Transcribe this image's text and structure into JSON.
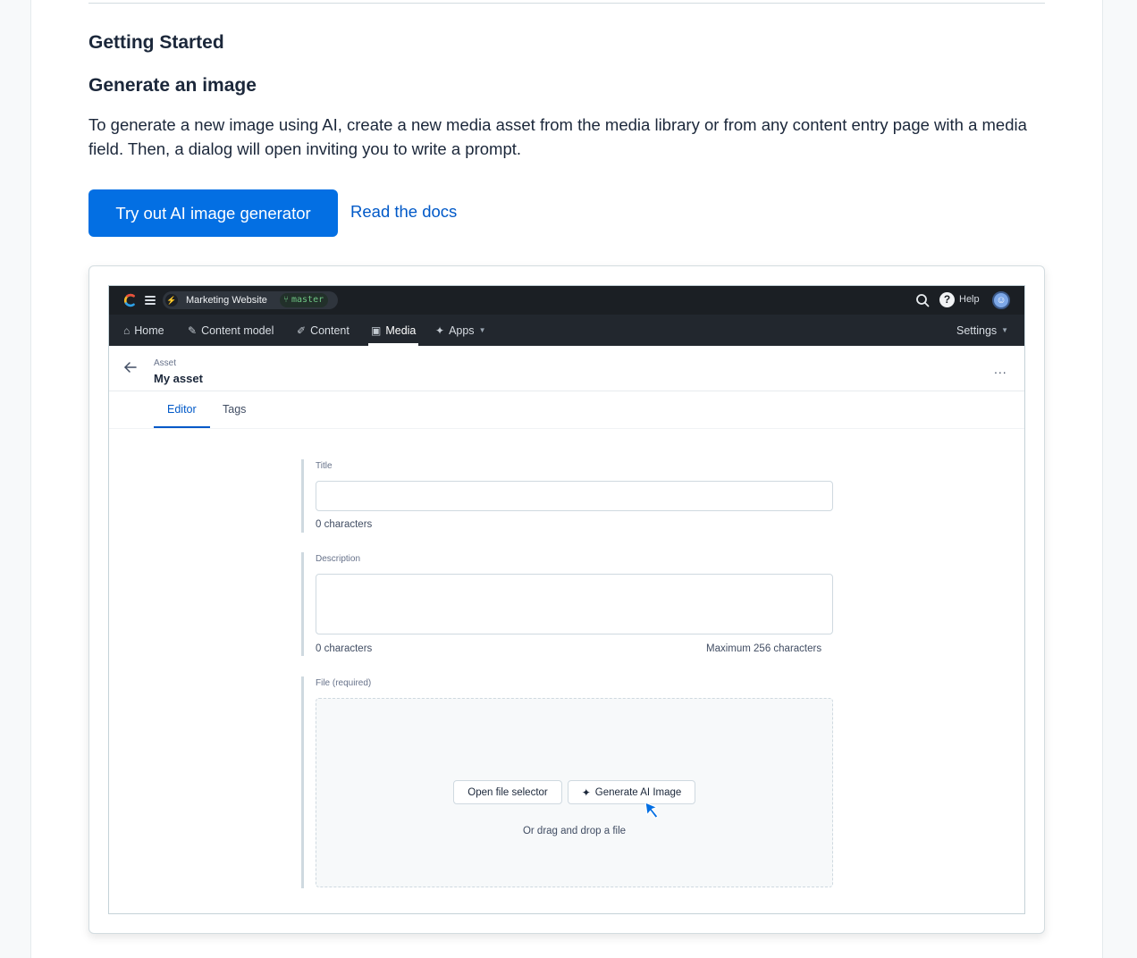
{
  "section": {
    "title": "Getting Started",
    "subtitle": "Generate an image",
    "intro": "To generate a new image using AI, create a new media asset from the media library or from any content entry page with a media field. Then, a dialog will open inviting you to write a prompt.",
    "primary_button": "Try out AI image generator",
    "docs_link": "Read the docs"
  },
  "screenshot": {
    "topbar": {
      "space_name": "Marketing Website",
      "environment": "master",
      "help_label": "Help"
    },
    "nav": {
      "items": [
        {
          "label": "Home",
          "icon": "home-icon"
        },
        {
          "label": "Content model",
          "icon": "wrench-icon"
        },
        {
          "label": "Content",
          "icon": "pen-icon"
        },
        {
          "label": "Media",
          "icon": "image-icon",
          "active": true
        },
        {
          "label": "Apps",
          "icon": "puzzle-icon"
        }
      ],
      "settings_label": "Settings"
    },
    "asset": {
      "kicker": "Asset",
      "title": "My asset",
      "more": "..."
    },
    "tabs": [
      "Editor",
      "Tags"
    ],
    "fields": {
      "title_label": "Title",
      "title_value": "",
      "title_count": "0 characters",
      "description_label": "Description",
      "description_value": "",
      "description_count": "0 characters",
      "description_max": "Maximum 256 characters",
      "file_label": "File (required)",
      "open_file_button": "Open file selector",
      "generate_button": "Generate AI Image",
      "drop_hint": "Or drag and drop a file"
    }
  },
  "colors": {
    "primary": "#036fe3",
    "link": "#0059c8",
    "app_topbar": "#1b1f24",
    "app_nav": "#22272e"
  }
}
